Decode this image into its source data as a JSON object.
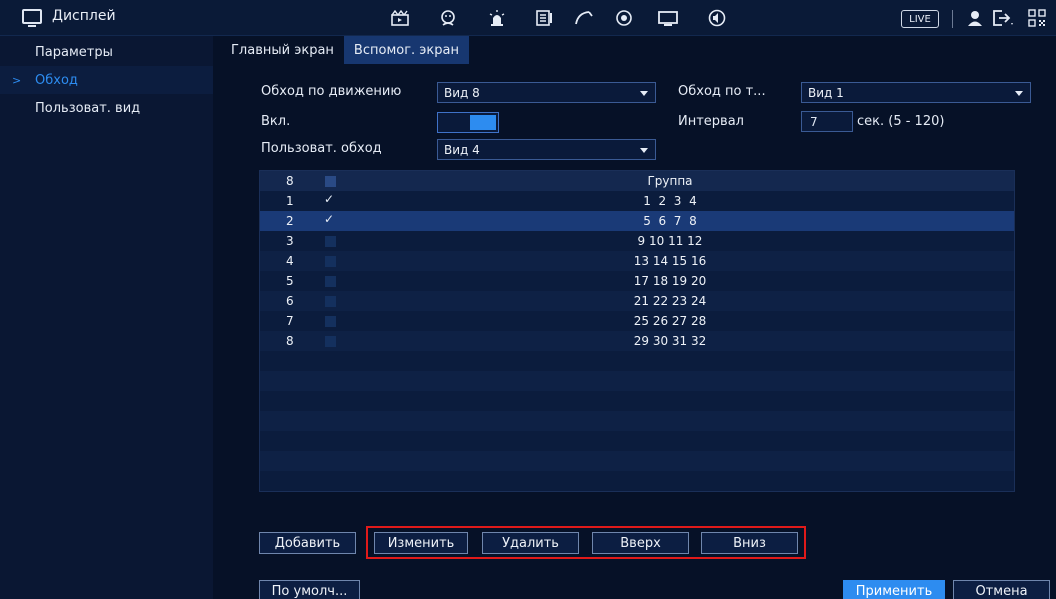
{
  "header": {
    "title": "Дисплей",
    "icons": [
      "display-icon",
      "clapper-icon",
      "face-icon",
      "alarm-icon",
      "storage-icon",
      "network-icon",
      "sync-icon",
      "monitor-icon",
      "audio-icon"
    ],
    "live_label": "LIVE",
    "right_icons": [
      "user-icon",
      "logout-icon",
      "qr-icon"
    ]
  },
  "sidebar": {
    "items": [
      {
        "label": "Параметры",
        "active": false
      },
      {
        "label": "Обход",
        "active": true
      },
      {
        "label": "Пользоват. вид",
        "active": false
      }
    ]
  },
  "tabs": [
    {
      "label": "Главный экран",
      "active": false
    },
    {
      "label": "Вспомог. экран",
      "active": true
    }
  ],
  "form": {
    "motion_tour_label": "Обход по движению",
    "motion_tour_value": "Вид 8",
    "alarm_tour_label": "Обход по т...",
    "alarm_tour_value": "Вид 1",
    "enable_label": "Вкл.",
    "enable_on": true,
    "interval_label": "Интервал",
    "interval_value": "7",
    "interval_unit": "сек. (5 - 120)",
    "custom_tour_label": "Пользоват. обход",
    "custom_tour_value": "Вид 4"
  },
  "table": {
    "header": {
      "index": "8",
      "group": "Группа"
    },
    "rows": [
      {
        "index": "1",
        "checked": true,
        "group": "1  2  3  4",
        "selected": false
      },
      {
        "index": "2",
        "checked": true,
        "group": "5  6  7  8",
        "selected": true
      },
      {
        "index": "3",
        "checked": false,
        "group": "9 10 11 12",
        "selected": false
      },
      {
        "index": "4",
        "checked": false,
        "group": "13 14 15 16",
        "selected": false
      },
      {
        "index": "5",
        "checked": false,
        "group": "17 18 19 20",
        "selected": false
      },
      {
        "index": "6",
        "checked": false,
        "group": "21 22 23 24",
        "selected": false
      },
      {
        "index": "7",
        "checked": false,
        "group": "25 26 27 28",
        "selected": false
      },
      {
        "index": "8",
        "checked": false,
        "group": "29 30 31 32",
        "selected": false
      }
    ]
  },
  "actions": {
    "add": "Добавить",
    "edit": "Изменить",
    "delete": "Удалить",
    "up": "Вверх",
    "down": "Вниз"
  },
  "footer": {
    "default": "По умолч...",
    "apply": "Применить",
    "cancel": "Отмена"
  },
  "colors": {
    "accent": "#2d8cf0",
    "highlight_frame": "#e01a1a",
    "background": "#061127"
  }
}
